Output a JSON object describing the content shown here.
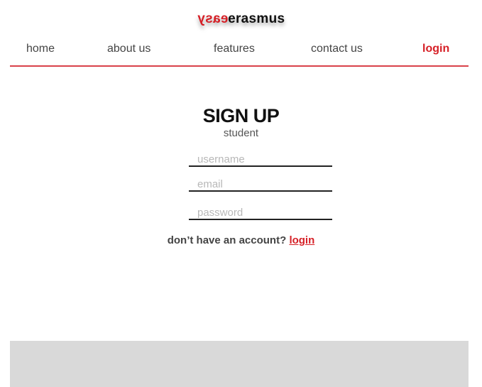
{
  "brand": {
    "logo_part1": "easy",
    "logo_part2": "erasmus"
  },
  "nav": {
    "home": "home",
    "about": "about us",
    "features": "features",
    "contact": "contact us",
    "login": "login"
  },
  "form": {
    "title": "SIGN UP",
    "subtitle": "student",
    "username_placeholder": "username",
    "email_placeholder": "email",
    "password_placeholder": "password",
    "account_prompt": "don’t have an account?",
    "account_link": "login"
  },
  "colors": {
    "accent": "#d61f26",
    "footer": "#d9d9d9"
  }
}
